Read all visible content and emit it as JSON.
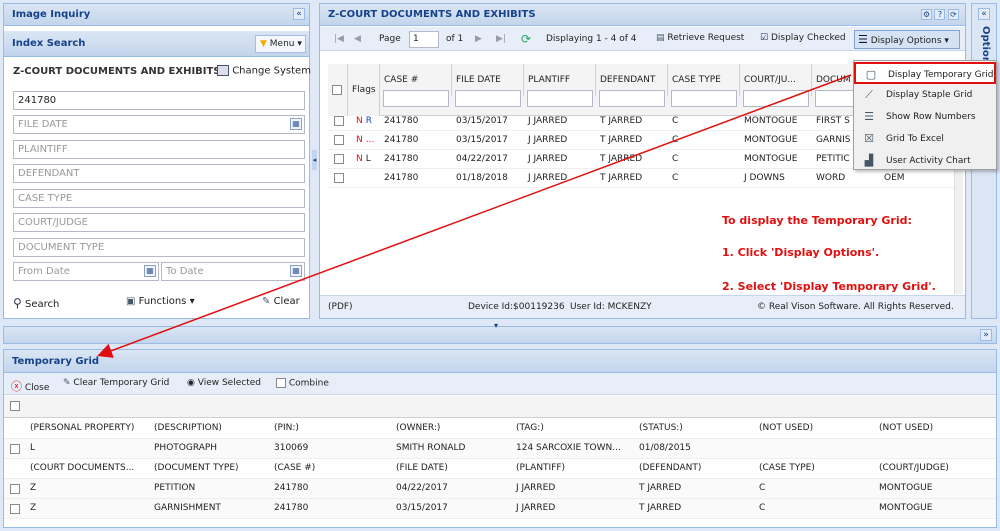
{
  "left_panel": {
    "title": "Image Inquiry",
    "collapse_label": "«",
    "index_search_title": "Index Search",
    "menu_label": "Menu ▾",
    "system_name": "Z-COURT DOCUMENTS AND EXHIBITS",
    "change_system_label": "Change System",
    "fields": {
      "case_value": "241780",
      "file_date_placeholder": "FILE DATE",
      "plaintiff_placeholder": "PLAINTIFF",
      "defendant_placeholder": "DEFENDANT",
      "case_type_placeholder": "CASE TYPE",
      "court_judge_placeholder": "COURT/JUDGE",
      "document_type_placeholder": "DOCUMENT TYPE",
      "from_date_placeholder": "From Date",
      "to_date_placeholder": "To Date"
    },
    "search_label": "Search",
    "functions_label": "Functions ▾",
    "clear_label": "Clear"
  },
  "main_panel": {
    "title": "Z-COURT DOCUMENTS AND EXHIBITS",
    "options_tab": "Options",
    "toolbar": {
      "page_label": "Page",
      "page_value": "1",
      "of_label": "of 1",
      "displaying": "Displaying 1 - 4 of 4",
      "retrieve_request": "Retrieve Request",
      "display_checked": "Display Checked",
      "display_options": "Display Options ▾"
    },
    "columns": [
      "Flags",
      "CASE #",
      "FILE DATE",
      "PLANTIFF",
      "DEFENDANT",
      "CASE TYPE",
      "COURT/JU...",
      "DOCUM"
    ],
    "rows": [
      {
        "flag1": "N",
        "flag2": "R",
        "case": "241780",
        "file_date": "03/15/2017",
        "plantiff": "J JARRED",
        "defendant": "T JARRED",
        "case_type": "C",
        "court": "MONTOGUE",
        "doc": "FIRST S"
      },
      {
        "flag1": "N",
        "flag2": "...",
        "case": "241780",
        "file_date": "03/15/2017",
        "plantiff": "J JARRED",
        "defendant": "T JARRED",
        "case_type": "C",
        "court": "MONTOGUE",
        "doc": "GARNIS"
      },
      {
        "flag1": "N",
        "flag2": "L",
        "case": "241780",
        "file_date": "04/22/2017",
        "plantiff": "J JARRED",
        "defendant": "T JARRED",
        "case_type": "C",
        "court": "MONTOGUE",
        "doc": "PETITIC"
      },
      {
        "flag1": "",
        "flag2": "",
        "case": "241780",
        "file_date": "01/18/2018",
        "plantiff": "J JARRED",
        "defendant": "T JARRED",
        "case_type": "C",
        "court": "J DOWNS",
        "doc": "WORD",
        "extra": "OEM"
      }
    ],
    "status_left": "(PDF)",
    "status_device": "Device Id:$00119236",
    "status_user": "User Id: MCKENZY",
    "status_right": "© Real Vison Software. All Rights Reserved."
  },
  "display_options_menu": {
    "items": [
      {
        "label": "Display Temporary Grid",
        "icon": "grid-icon"
      },
      {
        "label": "Display Staple Grid",
        "icon": "staple-icon"
      },
      {
        "label": "Show Row Numbers",
        "icon": "list-numbers-icon"
      },
      {
        "label": "Grid To Excel",
        "icon": "excel-icon"
      },
      {
        "label": "User Activity Chart",
        "icon": "chart-icon"
      }
    ]
  },
  "instructions": {
    "line1": "To display the Temporary Grid:",
    "line2": "1. Click 'Display Options'.",
    "line3": "2. Select 'Display Temporary Grid'."
  },
  "temp_grid": {
    "title": "Temporary Grid",
    "close_label": "Close",
    "clear_label": "Clear Temporary Grid",
    "view_selected_label": "View Selected",
    "combine_label": "Combine",
    "rows": [
      {
        "type": "header",
        "cells": [
          "(PERSONAL PROPERTY)",
          "(DESCRIPTION)",
          "(PIN:)",
          "(OWNER:)",
          "(TAG:)",
          "(STATUS:)",
          "(NOT USED)",
          "(NOT USED)"
        ]
      },
      {
        "type": "data",
        "cells": [
          "L",
          "PHOTOGRAPH",
          "310069",
          "SMITH RONALD",
          "124 SARCOXIE TOWN...",
          "01/08/2015",
          "",
          ""
        ]
      },
      {
        "type": "header",
        "cells": [
          "(COURT DOCUMENTS...",
          "(DOCUMENT TYPE)",
          "(CASE #)",
          "(FILE DATE)",
          "(PLANTIFF)",
          "(DEFENDANT)",
          "(CASE TYPE)",
          "(COURT/JUDGE)"
        ]
      },
      {
        "type": "data",
        "cells": [
          "Z",
          "PETITION",
          "241780",
          "04/22/2017",
          "J JARRED",
          "T JARRED",
          "C",
          "MONTOGUE"
        ]
      },
      {
        "type": "data",
        "cells": [
          "Z",
          "GARNISHMENT",
          "241780",
          "03/15/2017",
          "J JARRED",
          "T JARRED",
          "C",
          "MONTOGUE"
        ]
      }
    ]
  },
  "colors": {
    "accent": "#15428b",
    "instruction": "#e01010",
    "flag_n": "#e01010",
    "flag_r": "#1a3fd0",
    "highlight": "#e01010"
  }
}
